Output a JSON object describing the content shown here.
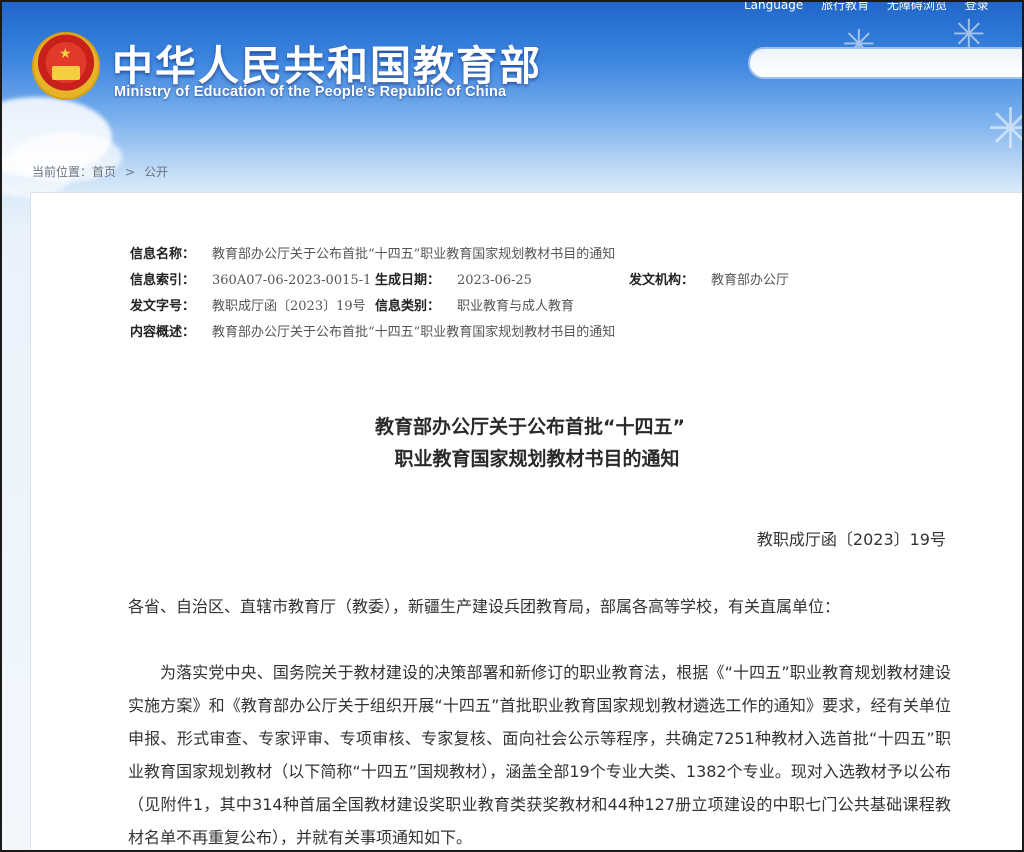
{
  "header": {
    "top_links": [
      "Language",
      "旅行教育",
      "无障碍浏览",
      "登录"
    ],
    "site_title": "中华人民共和国教育部",
    "site_subtitle": "Ministry of Education of the People's Republic of China",
    "search_placeholder": ""
  },
  "breadcrumb": {
    "prefix": "当前位置：",
    "items": [
      "首页",
      "公开"
    ],
    "separator": ">"
  },
  "meta": {
    "name_label": "信息名称：",
    "name_value": "教育部办公厅关于公布首批“十四五”职业教育国家规划教材书目的通知",
    "index_label": "信息索引：",
    "index_value": "360A07-06-2023-0015-1",
    "date_label": "生成日期：",
    "date_value": "2023-06-25",
    "org_label": "发文机构：",
    "org_value": "教育部办公厅",
    "docno_label": "发文字号：",
    "docno_value": "教职成厅函〔2023〕19号",
    "category_label": "信息类别：",
    "category_value": "职业教育与成人教育",
    "summary_label": "内容概述：",
    "summary_value": "教育部办公厅关于公布首批“十四五”职业教育国家规划教材书目的通知"
  },
  "document": {
    "title_line1": "教育部办公厅关于公布首批“十四五”",
    "title_line2": "职业教育国家规划教材书目的通知",
    "doc_number": "教职成厅函〔2023〕19号",
    "addressee": "各省、自治区、直辖市教育厅（教委），新疆生产建设兵团教育局，部属各高等学校，有关直属单位：",
    "paragraph1": "为落实党中央、国务院关于教材建设的决策部署和新修订的职业教育法，根据《“十四五”职业教育规划教材建设实施方案》和《教育部办公厅关于组织开展“十四五”首批职业教育国家规划教材遴选工作的通知》要求，经有关单位申报、形式审查、专家评审、专项审核、专家复核、面向社会公示等程序，共确定7251种教材入选首批“十四五”职业教育国家规划教材（以下简称“十四五”国规教材），涵盖全部19个专业大类、1382个专业。现对入选教材予以公布（见附件1，其中314种首届全国教材建设奖职业教育类获奖教材和44种127册立项建设的中职七门公共基础课程教材名单不再重复公布），并就有关事项通知如下。"
  },
  "colors": {
    "header_blue": "#1f66c9",
    "emblem_red": "#c8201a",
    "emblem_gold": "#e6b426"
  }
}
